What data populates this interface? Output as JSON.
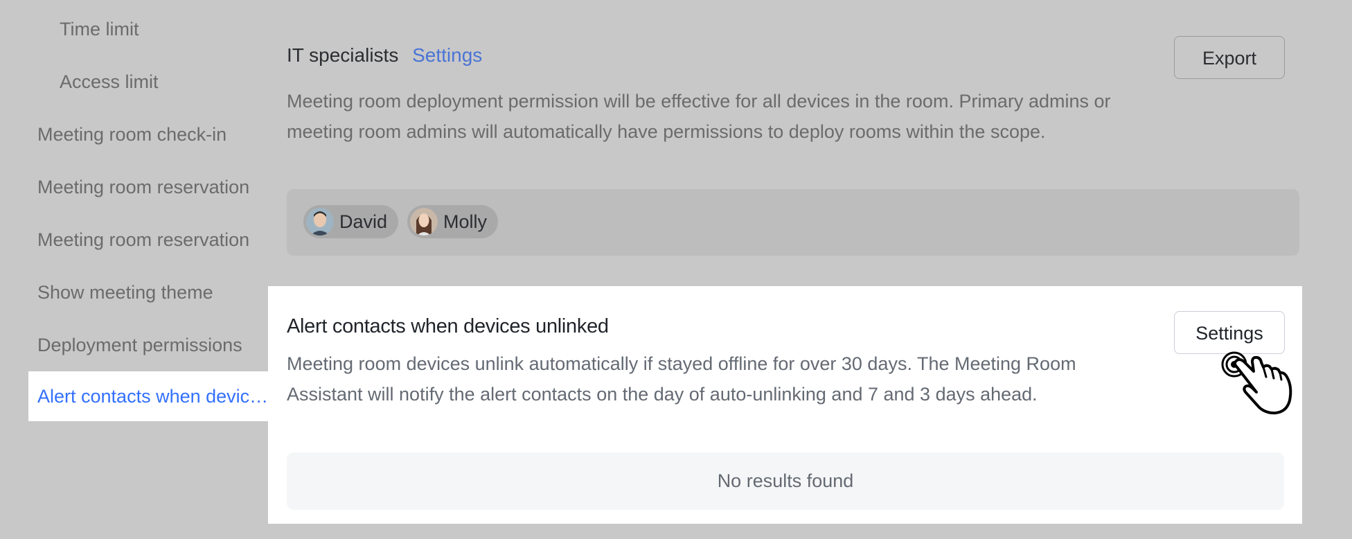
{
  "sidebar": {
    "items": [
      {
        "label": "Time limit"
      },
      {
        "label": "Access limit"
      },
      {
        "label": "Meeting room check-in"
      },
      {
        "label": "Meeting room reservation"
      },
      {
        "label": "Meeting room reservation"
      },
      {
        "label": "Show meeting theme"
      },
      {
        "label": "Deployment permissions"
      },
      {
        "label": "Alert contacts when devices unlinked"
      }
    ]
  },
  "deployment_section": {
    "title": "IT specialists",
    "settings_link": "Settings",
    "export_label": "Export",
    "description": "Meeting room deployment permission will be effective for all devices in the room. Primary admins or meeting room admins will automatically have permissions to deploy rooms within the scope.",
    "members": [
      {
        "name": "David"
      },
      {
        "name": "Molly"
      }
    ]
  },
  "alert_section": {
    "title": "Alert contacts when devices unlinked",
    "settings_label": "Settings",
    "description": "Meeting room devices unlink automatically if stayed offline for over 30 days. The Meeting Room Assistant will notify the alert contacts on the day of auto-unlinking and 7 and 3 days ahead.",
    "empty_text": "No results found"
  },
  "colors": {
    "accent": "#3370ff",
    "overlay": "#c8c8c8"
  }
}
